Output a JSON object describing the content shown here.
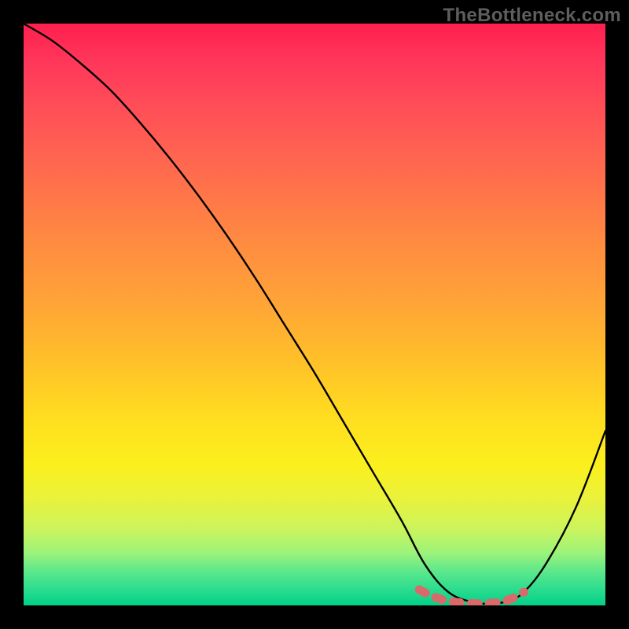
{
  "watermark": "TheBottleneck.com",
  "chart_data": {
    "type": "line",
    "title": "",
    "xlabel": "",
    "ylabel": "",
    "xlim": [
      0,
      100
    ],
    "ylim": [
      0,
      100
    ],
    "grid": false,
    "annotations": [
      "Gradient background from red (high bottleneck) through yellow to green (low bottleneck)"
    ],
    "series": [
      {
        "name": "bottleneck-curve",
        "color": "#000000",
        "x": [
          0,
          5,
          10,
          15,
          20,
          25,
          30,
          35,
          40,
          45,
          50,
          55,
          60,
          65,
          69,
          73,
          77,
          80,
          83,
          86,
          90,
          95,
          100
        ],
        "values": [
          100,
          97,
          93,
          88.5,
          83,
          77,
          70.5,
          63.5,
          56,
          48,
          40,
          31.5,
          23,
          14.5,
          7,
          2.3,
          0.6,
          0.3,
          0.7,
          2.3,
          7.5,
          17,
          30
        ]
      },
      {
        "name": "min-highlight",
        "color": "#d96a6a",
        "x": [
          68,
          70,
          72,
          74,
          76,
          78,
          80,
          82,
          84,
          86
        ],
        "values": [
          2.7,
          1.7,
          1.0,
          0.6,
          0.4,
          0.3,
          0.35,
          0.6,
          1.2,
          2.3
        ]
      }
    ],
    "background_gradient_stops": [
      {
        "pos": 0,
        "color": "#ff1f4e"
      },
      {
        "pos": 25,
        "color": "#ff6a4e"
      },
      {
        "pos": 50,
        "color": "#ffb030"
      },
      {
        "pos": 75,
        "color": "#f5ee20"
      },
      {
        "pos": 90,
        "color": "#8ef17e"
      },
      {
        "pos": 100,
        "color": "#00d186"
      }
    ]
  }
}
